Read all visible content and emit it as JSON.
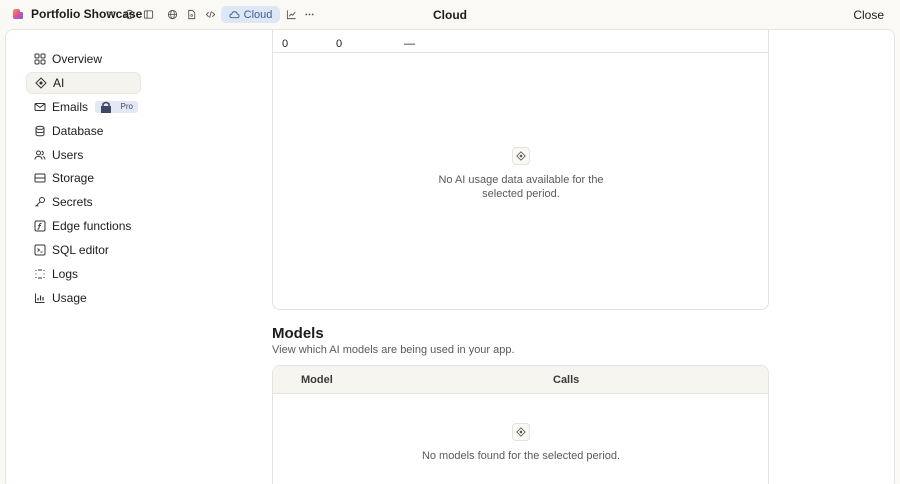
{
  "topbar": {
    "project_name": "Portfolio Showcase",
    "cloud_label": "Cloud",
    "title": "Cloud",
    "close_label": "Close"
  },
  "sidebar": {
    "items": [
      {
        "label": "Overview",
        "icon": "grid-icon"
      },
      {
        "label": "AI",
        "icon": "ai-icon",
        "active": true
      },
      {
        "label": "Emails",
        "icon": "mail-icon",
        "badge": "Pro"
      },
      {
        "label": "Database",
        "icon": "database-icon"
      },
      {
        "label": "Users",
        "icon": "users-icon"
      },
      {
        "label": "Storage",
        "icon": "storage-icon"
      },
      {
        "label": "Secrets",
        "icon": "key-icon"
      },
      {
        "label": "Edge functions",
        "icon": "function-icon"
      },
      {
        "label": "SQL editor",
        "icon": "terminal-icon"
      },
      {
        "label": "Logs",
        "icon": "logs-icon"
      },
      {
        "label": "Usage",
        "icon": "chart-icon"
      }
    ]
  },
  "usage": {
    "row_values": [
      "0",
      "0",
      "—"
    ],
    "empty_text": "No AI usage data available for the selected period."
  },
  "models": {
    "title": "Models",
    "subtitle": "View which AI models are being used in your app.",
    "columns": [
      "Model",
      "Calls"
    ],
    "empty_text": "No models found for the selected period."
  },
  "colors": {
    "accent": "#3d5f93",
    "cloud_bg": "#dde7f6",
    "page_bg": "#faf9f6"
  }
}
